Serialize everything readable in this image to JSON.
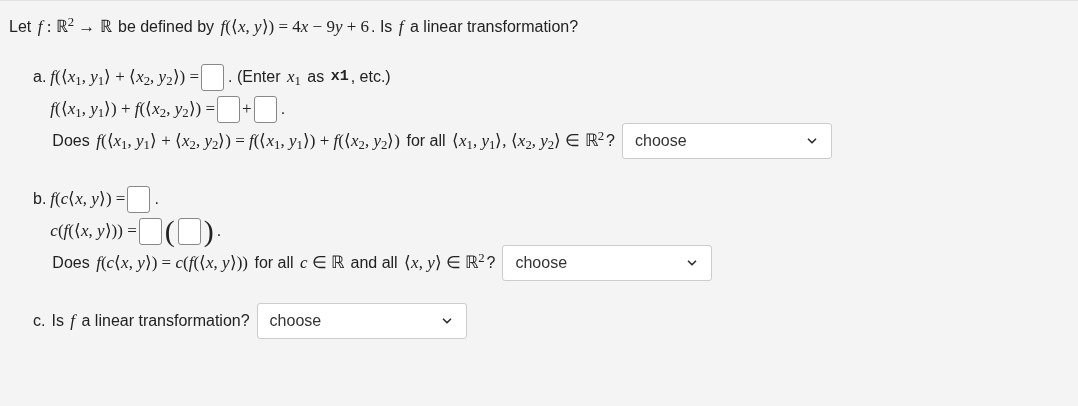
{
  "intro": [
    {
      "kind": "text",
      "text": "Let "
    },
    {
      "kind": "math",
      "text": "*f* : ℝ$^{2}$ → ℝ"
    },
    {
      "kind": "text",
      "text": " be defined by "
    },
    {
      "kind": "math",
      "text": "*f*(⟨*x*, *y*⟩) = 4"
    },
    {
      "kind": "math",
      "text": "*x*"
    },
    {
      "kind": "math",
      "text": " − 9"
    },
    {
      "kind": "math",
      "text": "*y*"
    },
    {
      "kind": "math",
      "text": " + 6"
    },
    {
      "kind": "text",
      "text": ". Is "
    },
    {
      "kind": "math",
      "text": "*f*"
    },
    {
      "kind": "text",
      "text": " a linear transformation?"
    }
  ],
  "parts": [
    {
      "marker": "a.",
      "lines": [
        [
          {
            "kind": "math",
            "text": "*f*(⟨*x*$_{1}$, *y*$_{1}$⟩ + ⟨*x*$_{2}$, *y*$_{2}$⟩) ="
          },
          {
            "kind": "box"
          },
          {
            "kind": "text",
            "text": ". (Enter "
          },
          {
            "kind": "math",
            "text": "*x*$_{1}$"
          },
          {
            "kind": "text",
            "text": " as "
          },
          {
            "kind": "code",
            "text": "x1"
          },
          {
            "kind": "text",
            "text": ", etc.)"
          }
        ],
        [
          {
            "kind": "math",
            "text": "*f*(⟨*x*$_{1}$, *y*$_{1}$⟩) + *f*(⟨*x*$_{2}$, *y*$_{2}$⟩) ="
          },
          {
            "kind": "box"
          },
          {
            "kind": "math",
            "text": "+"
          },
          {
            "kind": "box"
          },
          {
            "kind": "text",
            "text": "."
          }
        ],
        [
          {
            "kind": "text",
            "text": "Does "
          },
          {
            "kind": "math",
            "text": "*f*(⟨*x*$_{1}$, *y*$_{1}$⟩ + ⟨*x*$_{2}$, *y*$_{2}$⟩) = *f*(⟨*x*$_{1}$, *y*$_{1}$⟩) + *f*(⟨*x*$_{2}$, *y*$_{2}$⟩)"
          },
          {
            "kind": "text",
            "text": " for all "
          },
          {
            "kind": "math",
            "text": "⟨*x*$_{1}$, *y*$_{1}$⟩, ⟨*x*$_{2}$, *y*$_{2}$⟩ ∈ ℝ$^{2}$"
          },
          {
            "kind": "text",
            "text": "?"
          },
          {
            "kind": "select",
            "value": "choose"
          }
        ]
      ]
    },
    {
      "marker": "b.",
      "lines": [
        [
          {
            "kind": "math",
            "text": "*f*(*c*⟨*x*, *y*⟩) ="
          },
          {
            "kind": "box"
          },
          {
            "kind": "text",
            "text": "."
          }
        ],
        [
          {
            "kind": "math",
            "text": "*c*(*f*(⟨*x*, *y*⟩)) ="
          },
          {
            "kind": "box"
          },
          {
            "kind": "paren",
            "text": "("
          },
          {
            "kind": "box"
          },
          {
            "kind": "paren",
            "text": ")"
          },
          {
            "kind": "text",
            "text": "."
          }
        ],
        [
          {
            "kind": "text",
            "text": "Does "
          },
          {
            "kind": "math",
            "text": "*f*(*c*⟨*x*, *y*⟩) = *c*(*f*(⟨*x*, *y*⟩))"
          },
          {
            "kind": "text",
            "text": " for all "
          },
          {
            "kind": "math",
            "text": "*c* ∈ ℝ"
          },
          {
            "kind": "text",
            "text": " and all "
          },
          {
            "kind": "math",
            "text": "⟨*x*, *y*⟩ ∈ ℝ$^{2}$"
          },
          {
            "kind": "text",
            "text": "?"
          },
          {
            "kind": "select",
            "value": "choose"
          }
        ]
      ]
    },
    {
      "marker": "c.",
      "lines": [
        [
          {
            "kind": "text",
            "text": "Is "
          },
          {
            "kind": "math",
            "text": "*f*"
          },
          {
            "kind": "text",
            "text": " a linear transformation?"
          },
          {
            "kind": "select",
            "value": "choose"
          }
        ]
      ]
    }
  ]
}
